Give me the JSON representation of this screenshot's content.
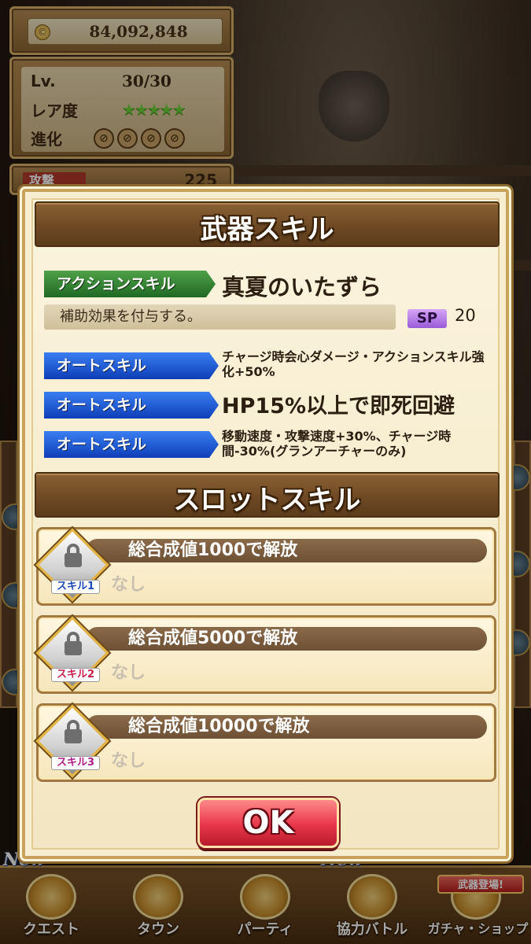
{
  "status": {
    "coins": "84,092,848",
    "coin_symbol": "©",
    "level_label": "Lv.",
    "level_value": "30/30",
    "rarity_label": "レア度",
    "rarity_stars": "★★★★★",
    "evolution_label": "進化",
    "attack_label": "攻撃",
    "attack_value": "225"
  },
  "modal": {
    "title": "武器スキル",
    "action_skill": {
      "tag": "アクションスキル",
      "name": "真夏のいたずら",
      "description": "補助効果を付与する。",
      "sp_label": "SP",
      "sp_value": "20"
    },
    "auto_skills": [
      {
        "tag": "オートスキル",
        "text": "チャージ時会心ダメージ・アクションスキル強化+50%"
      },
      {
        "tag": "オートスキル",
        "text": "HP15%以上で即死回避"
      },
      {
        "tag": "オートスキル",
        "text": "移動速度・攻撃速度+30%、チャージ時間-30%(グランアーチャーのみ)"
      }
    ],
    "slot_title": "スロットスキル",
    "slots": [
      {
        "tag": "スキル1",
        "unlock": "総合成値1000で解放",
        "value": "なし"
      },
      {
        "tag": "スキル2",
        "unlock": "総合成値5000で解放",
        "value": "なし"
      },
      {
        "tag": "スキル3",
        "unlock": "総合成値10000で解放",
        "value": "なし"
      }
    ],
    "ok_label": "OK"
  },
  "bottom_nav": {
    "items": [
      "クエスト",
      "タウン",
      "パーティ",
      "協力バトル",
      "ガチャ・ショップ"
    ],
    "new_label": "New",
    "gacha_banner": "武器登場!"
  },
  "colors": {
    "header_brown": "#6e4a24",
    "action_green": "#1f6a24",
    "auto_blue": "#0e3eb8",
    "ok_red": "#e8364a",
    "panel_cream": "#f7eed2"
  }
}
